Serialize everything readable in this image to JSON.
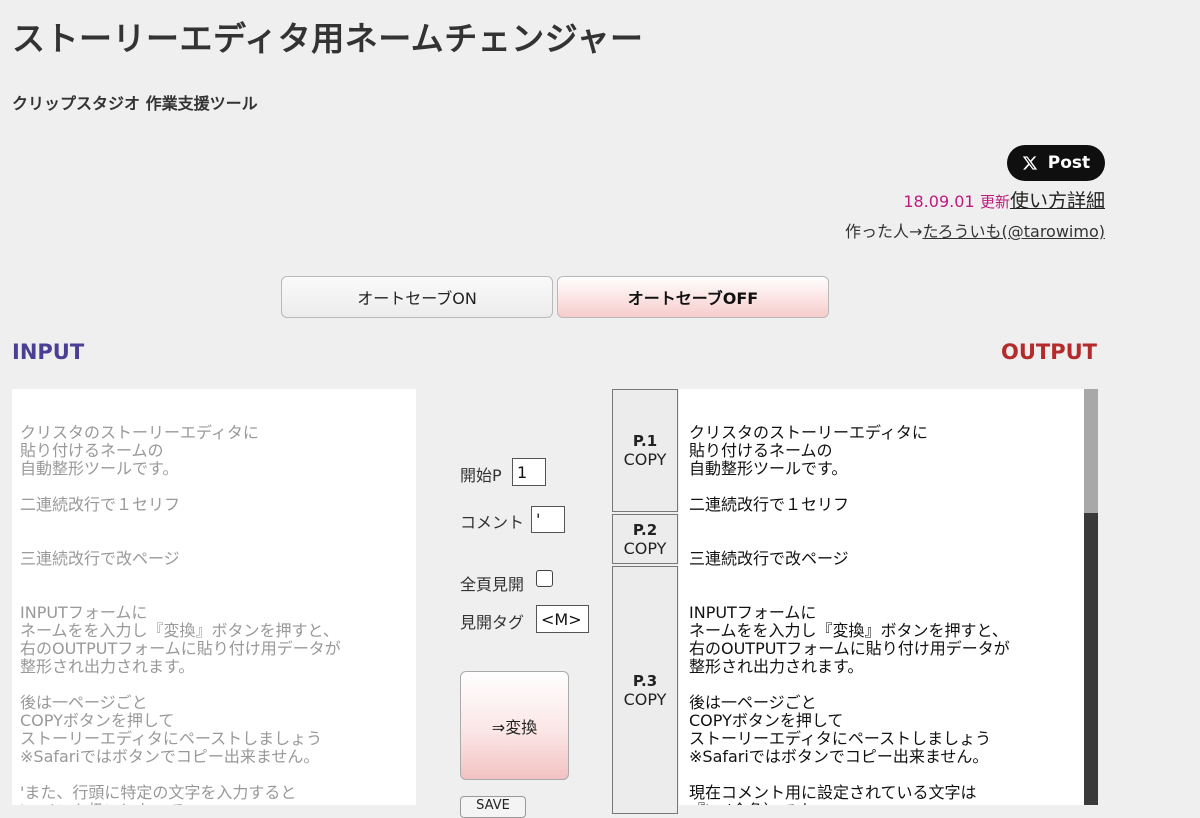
{
  "header": {
    "title": "ストーリーエディタ用ネームチェンジャー",
    "subtitle": "クリップスタジオ 作業支援ツール"
  },
  "share": {
    "post_label": "Post"
  },
  "update": {
    "date": "18.09.01",
    "word": "更新",
    "usage_link": "使い方詳細"
  },
  "author": {
    "prefix": "作った人→",
    "link": "たろういも(@tarowimo)"
  },
  "autosave": {
    "on_label": "オートセーブON",
    "off_label": "オートセーブOFF"
  },
  "labels": {
    "input": "INPUT",
    "output": "OUTPUT"
  },
  "input_text": "クリスタのストーリーエディタに\n貼り付けるネームの\n自動整形ツールです。\n\n二連続改行で１セリフ\n\n\n三連続改行で改ページ\n\n\nINPUTフォームに\nネームをを入力し『変換』ボタンを押すと、\n右のOUTPUTフォームに貼り付け用データが\n整形され出力されます。\n\n後は一ページごと\nCOPYボタンを押して\nストーリーエディタにペーストしましょう\n※Safariではボタンでコピー出来ません。\n\n'また、行頭に特定の文字を入力すると\n'コメント扱いになって\n'右の出力エリアに出力されません。",
  "controls": {
    "start_label": "開始P",
    "start_value": "1",
    "comment_label": "コメント",
    "comment_value": "'",
    "spread_label": "全頁見開",
    "spread_checked": false,
    "tag_label": "見開タグ",
    "tag_value": "<M>",
    "convert_label": "⇒変換",
    "save_label": "SAVE"
  },
  "pages": [
    {
      "page": "P.1",
      "copy": "COPY"
    },
    {
      "page": "P.2",
      "copy": "COPY"
    },
    {
      "page": "P.3",
      "copy": "COPY"
    }
  ],
  "output_text": "クリスタのストーリーエディタに\n貼り付けるネームの\n自動整形ツールです。\n\n二連続改行で１セリフ\n\n\n三連続改行で改ページ\n\n\nINPUTフォームに\nネームをを入力し『変換』ボタンを押すと、\n右のOUTPUTフォームに貼り付け用データが\n整形され出力されます。\n\n後は一ページごと\nCOPYボタンを押して\nストーリーエディタにペーストしましょう\n※Safariではボタンでコピー出来ません。\n\n現在コメント用に設定されている文字は\n『'』(全角）です。\nコメント用文字は変更可能です。",
  "colors": {
    "background": "#efefef",
    "input_label": "#4b3f95",
    "output_label": "#b52a2a",
    "update_accent": "#c0197f"
  }
}
